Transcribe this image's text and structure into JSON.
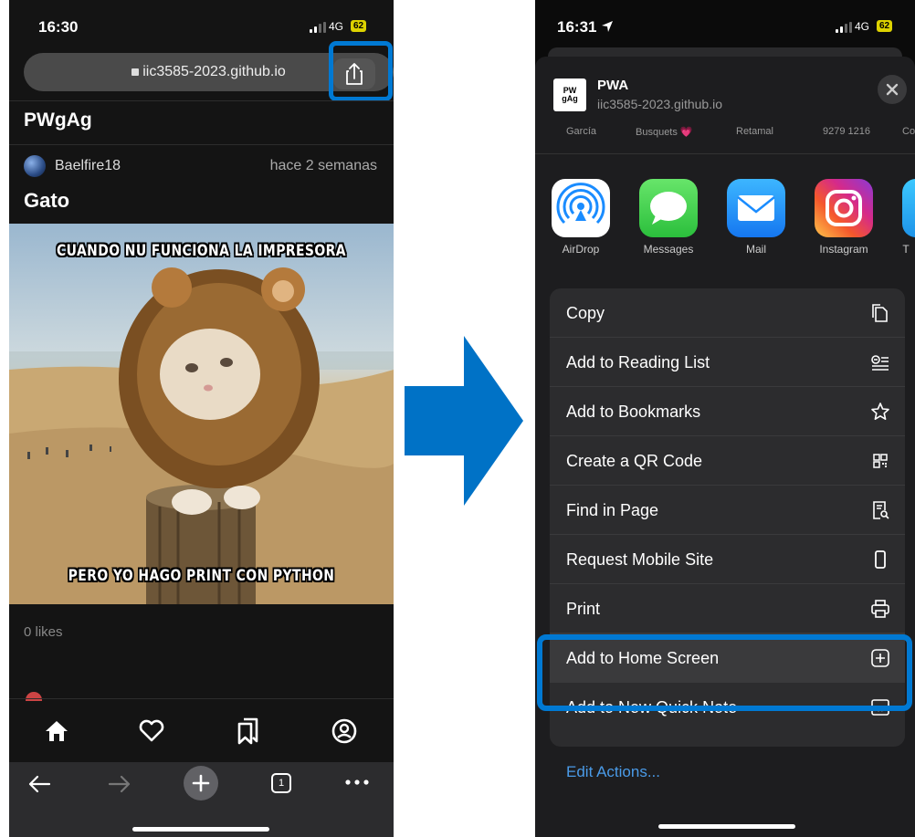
{
  "left": {
    "status": {
      "time": "16:30",
      "network": "4G",
      "battery": "62"
    },
    "url": "iic3585-2023.github.io",
    "app_title": "PWgAg",
    "post": {
      "username": "Baelfire18",
      "time_ago": "hace 2 semanas",
      "title": "Gato",
      "caption_top": "CUANDO NU FUNCIONA LA IMPRESORA",
      "caption_bottom": "PERO YO HAGO PRINT CON PYTHON",
      "likes": "0 likes"
    },
    "tab_icons": [
      "home-icon",
      "heart-icon",
      "bookmarks-icon",
      "profile-icon"
    ],
    "browser_tabs_count": "1"
  },
  "right": {
    "status": {
      "time": "16:31",
      "network": "4G",
      "battery": "62"
    },
    "share_header": {
      "title": "PWA",
      "url": "iic3585-2023.github.io",
      "logo_line1": "PW",
      "logo_line2": "gAg"
    },
    "contacts": [
      "García",
      "Busquets 💗",
      "Retamal",
      "9279 1216",
      "Co"
    ],
    "apps": [
      {
        "label": "AirDrop"
      },
      {
        "label": "Messages"
      },
      {
        "label": "Mail"
      },
      {
        "label": "Instagram"
      },
      {
        "label": "T"
      }
    ],
    "actions": [
      {
        "label": "Copy",
        "icon": "copy-icon"
      },
      {
        "label": "Add to Reading List",
        "icon": "reading-list-icon"
      },
      {
        "label": "Add to Bookmarks",
        "icon": "star-icon"
      },
      {
        "label": "Create a QR Code",
        "icon": "qr-code-icon"
      },
      {
        "label": "Find in Page",
        "icon": "find-in-page-icon"
      },
      {
        "label": "Request Mobile Site",
        "icon": "phone-icon"
      },
      {
        "label": "Print",
        "icon": "printer-icon"
      },
      {
        "label": "Add to Home Screen",
        "icon": "plus-square-icon"
      },
      {
        "label": "Add to New Quick Note",
        "icon": "quick-note-icon"
      }
    ],
    "edit_actions": "Edit Actions..."
  },
  "colors": {
    "highlight": "#0079d3",
    "arrow": "#0072c6",
    "link": "#4a9be8"
  }
}
